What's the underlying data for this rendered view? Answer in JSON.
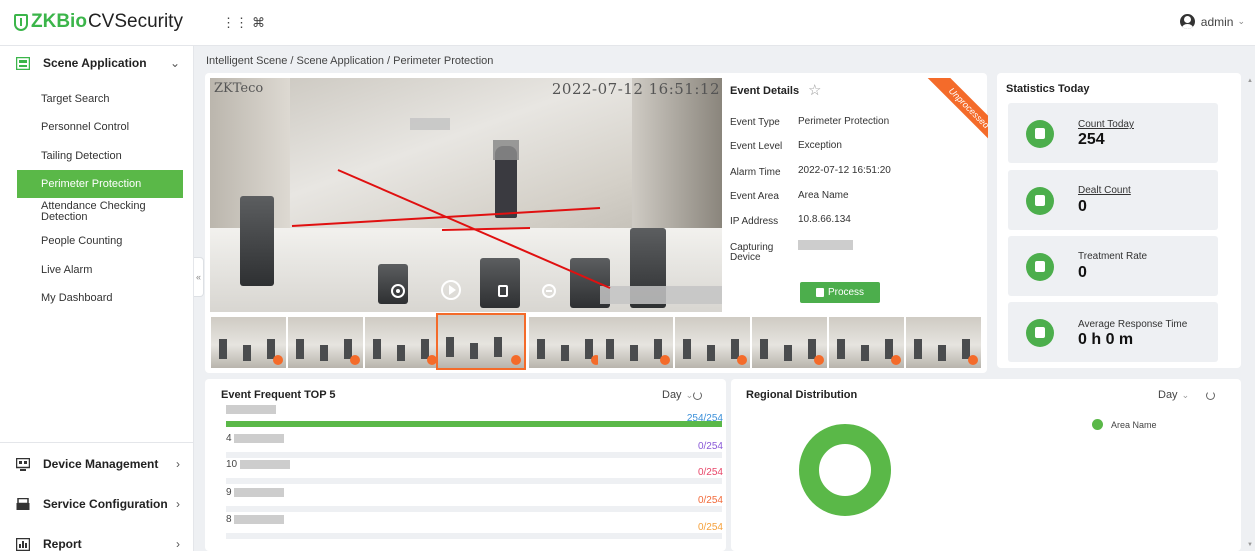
{
  "app": {
    "logo_zk": "ZKBio",
    "logo_rest": " CVSecurity",
    "user": "admin"
  },
  "sidebar": {
    "scene_group": "Scene Application",
    "items": [
      {
        "label": "Target Search"
      },
      {
        "label": "Personnel Control"
      },
      {
        "label": "Tailing Detection"
      },
      {
        "label": "Perimeter Protection"
      },
      {
        "label": "Attendance Checking Detection"
      },
      {
        "label": "People Counting"
      },
      {
        "label": "Live Alarm"
      },
      {
        "label": "My Dashboard"
      }
    ],
    "groups": [
      {
        "label": "Device Management"
      },
      {
        "label": "Service Configuration"
      },
      {
        "label": "Report"
      }
    ]
  },
  "breadcrumb": "Intelligent Scene / Scene Application / Perimeter Protection",
  "video": {
    "osd_brand": "ZKTeco",
    "osd_time": "2022-07-12 16:51:12"
  },
  "event": {
    "title": "Event Details",
    "ribbon": "Unprocessed",
    "rows": [
      {
        "label": "Event Type",
        "value": "Perimeter Protection"
      },
      {
        "label": "Event Level",
        "value": "Exception"
      },
      {
        "label": "Alarm Time",
        "value": "2022-07-12 16:51:20"
      },
      {
        "label": "Event Area",
        "value": "Area Name"
      },
      {
        "label": "IP Address",
        "value": "10.8.66.134"
      },
      {
        "label": "Capturing Device",
        "value": ""
      }
    ],
    "process_label": "Process"
  },
  "stats": {
    "title": "Statistics Today",
    "cards": [
      {
        "label": "Count Today",
        "value": "254",
        "icon": "running-person-icon"
      },
      {
        "label": "Dealt Count",
        "value": "0",
        "icon": "clipboard-check-icon"
      },
      {
        "label": "Treatment Rate",
        "value": "0",
        "icon": "pie-chart-icon"
      },
      {
        "label": "Average Response Time",
        "value": "0 h 0 m",
        "icon": "stopwatch-icon"
      }
    ]
  },
  "frequent": {
    "title": "Event Frequent TOP 5",
    "period": "Day",
    "bars": [
      {
        "label": "",
        "value": "254/254",
        "fraction": 1.0,
        "color": "#3a8fd9"
      },
      {
        "label": "4",
        "value": "0/254",
        "fraction": 0,
        "color": "#8a5ad8"
      },
      {
        "label": "10",
        "value": "0/254",
        "fraction": 0,
        "color": "#e8476a"
      },
      {
        "label": "9",
        "value": "0/254",
        "fraction": 0,
        "color": "#f26a3a"
      },
      {
        "label": "8",
        "value": "0/254",
        "fraction": 0,
        "color": "#f5a03a"
      }
    ]
  },
  "regional": {
    "title": "Regional Distribution",
    "period": "Day",
    "legend": "Area Name",
    "accent": "#5ab848"
  }
}
